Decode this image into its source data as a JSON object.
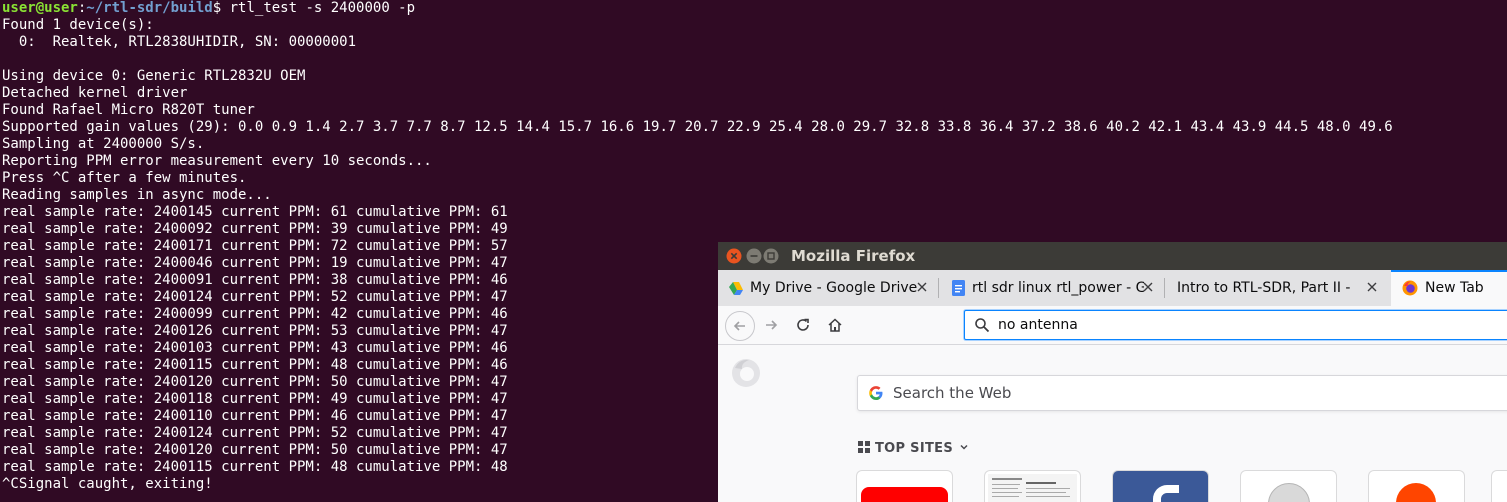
{
  "terminal": {
    "prompt_user": "user@user",
    "prompt_sep": ":",
    "prompt_path": "~/rtl-sdr/build",
    "prompt_symbol": "$",
    "command": " rtl_test -s 2400000 -p",
    "lines": [
      "Found 1 device(s):",
      "  0:  Realtek, RTL2838UHIDIR, SN: 00000001",
      "",
      "Using device 0: Generic RTL2832U OEM",
      "Detached kernel driver",
      "Found Rafael Micro R820T tuner",
      "Supported gain values (29): 0.0 0.9 1.4 2.7 3.7 7.7 8.7 12.5 14.4 15.7 16.6 19.7 20.7 22.9 25.4 28.0 29.7 32.8 33.8 36.4 37.2 38.6 40.2 42.1 43.4 43.9 44.5 48.0 49.6",
      "Sampling at 2400000 S/s.",
      "Reporting PPM error measurement every 10 seconds...",
      "Press ^C after a few minutes.",
      "Reading samples in async mode...",
      "real sample rate: 2400145 current PPM: 61 cumulative PPM: 61",
      "real sample rate: 2400092 current PPM: 39 cumulative PPM: 49",
      "real sample rate: 2400171 current PPM: 72 cumulative PPM: 57",
      "real sample rate: 2400046 current PPM: 19 cumulative PPM: 47",
      "real sample rate: 2400091 current PPM: 38 cumulative PPM: 46",
      "real sample rate: 2400124 current PPM: 52 cumulative PPM: 47",
      "real sample rate: 2400099 current PPM: 42 cumulative PPM: 46",
      "real sample rate: 2400126 current PPM: 53 cumulative PPM: 47",
      "real sample rate: 2400103 current PPM: 43 cumulative PPM: 46",
      "real sample rate: 2400115 current PPM: 48 cumulative PPM: 46",
      "real sample rate: 2400120 current PPM: 50 cumulative PPM: 47",
      "real sample rate: 2400118 current PPM: 49 cumulative PPM: 47",
      "real sample rate: 2400110 current PPM: 46 cumulative PPM: 47",
      "real sample rate: 2400124 current PPM: 52 cumulative PPM: 47",
      "real sample rate: 2400120 current PPM: 50 cumulative PPM: 47",
      "real sample rate: 2400115 current PPM: 48 cumulative PPM: 48",
      "^CSignal caught, exiting!"
    ]
  },
  "firefox": {
    "window_title": "Mozilla Firefox",
    "tabs": [
      {
        "label": "My Drive - Google Drive",
        "icon": "google-drive-icon"
      },
      {
        "label": "rtl sdr linux rtl_power - G",
        "icon": "google-docs-icon"
      },
      {
        "label": "Intro to RTL-SDR, Part II - So",
        "icon": "none"
      },
      {
        "label": "New Tab",
        "icon": "firefox-icon",
        "active": true
      }
    ],
    "urlbar_value": "no antenna",
    "search_placeholder": "Search the Web",
    "top_sites_heading": "TOP SITES",
    "colors": {
      "accent": "#0a84ff",
      "terminal_bg": "#300a24",
      "titlebar": "#3c3b37"
    }
  }
}
